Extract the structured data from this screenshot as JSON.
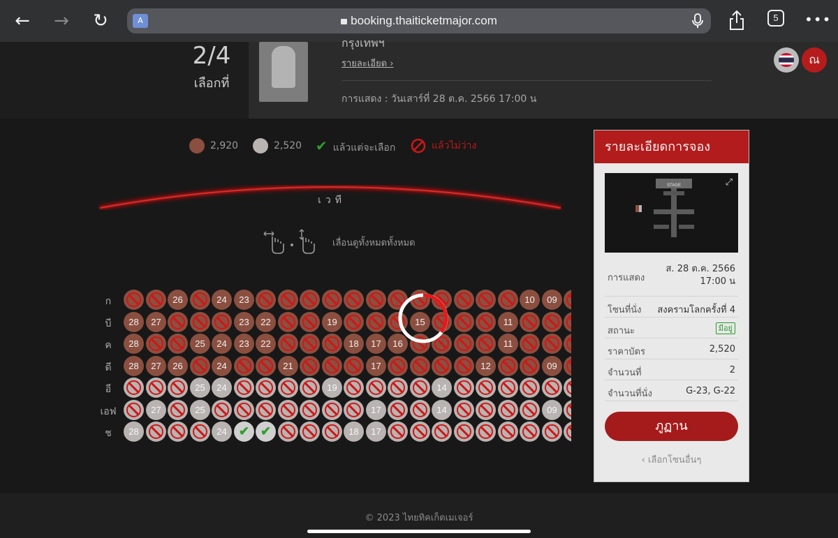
{
  "browser": {
    "url": "booking.thaiticketmajor.com",
    "tab_count": "5",
    "more": "•••",
    "translate": "A"
  },
  "event": {
    "step": "2/4",
    "step_label": "เลือกที่",
    "title": "กรุงเทพฯ",
    "detail_link": "รายละเอียด ›",
    "show": "การแสดง   : วันเสาร์ที่ 28 ต.ค. 2566 17:00 น"
  },
  "user": {
    "initial": "ณ"
  },
  "legend": [
    {
      "label": "2,920",
      "color": "#8b4f40"
    },
    {
      "label": "2,520",
      "color": "#b9b4b2"
    },
    {
      "label": "แล้วแต่จะเลือก",
      "color": "#2f9e2c"
    },
    {
      "label": "แล้วไม่ว่าง",
      "color": "#cf1717"
    }
  ],
  "stage": {
    "label": "เวที",
    "hint": "เลื่อนดูทั้งหมดทั้งหมด"
  },
  "seat_rows": [
    {
      "label": "ก",
      "seats": [
        "x",
        "x",
        "26",
        "x",
        "24",
        "23",
        "x",
        "x",
        "x",
        "x",
        "x",
        "x",
        "x",
        "x",
        "x",
        "x",
        "x",
        "x",
        "10",
        "09",
        "x"
      ],
      "zone": "z1"
    },
    {
      "label": "บี",
      "seats": [
        "28",
        "27",
        "x",
        "x",
        "x",
        "23",
        "22",
        "x",
        "x",
        "19",
        "x",
        "x",
        "x",
        "15",
        "x",
        "x",
        "x",
        "11",
        "x",
        "x",
        "x"
      ],
      "zone": "z1"
    },
    {
      "label": "ค",
      "seats": [
        "28",
        "x",
        "x",
        "25",
        "24",
        "23",
        "22",
        "x",
        "x",
        "x",
        "18",
        "17",
        "16",
        "x",
        "x",
        "x",
        "x",
        "11",
        "x",
        "x",
        "x"
      ],
      "zone": "z1"
    },
    {
      "label": "ดี",
      "seats": [
        "28",
        "27",
        "26",
        "x",
        "24",
        "x",
        "x",
        "21",
        "x",
        "x",
        "x",
        "17",
        "x",
        "x",
        "x",
        "x",
        "12",
        "x",
        "x",
        "09",
        "x"
      ],
      "zone": "z1"
    },
    {
      "label": "อี",
      "seats": [
        "x",
        "x",
        "x",
        "25",
        "24",
        "x",
        "x",
        "x",
        "x",
        "19",
        "x",
        "x",
        "x",
        "x",
        "14",
        "x",
        "x",
        "x",
        "x",
        "x",
        "x"
      ],
      "zone": "z2"
    },
    {
      "label": "เอฟ",
      "seats": [
        "x",
        "27",
        "x",
        "25",
        "x",
        "x",
        "x",
        "x",
        "x",
        "x",
        "x",
        "17",
        "x",
        "x",
        "14",
        "x",
        "x",
        "x",
        "x",
        "09",
        "x"
      ],
      "zone": "z2"
    },
    {
      "label": "ช",
      "seats": [
        "28",
        "x",
        "x",
        "x",
        "24",
        "v",
        "v",
        "x",
        "x",
        "x",
        "18",
        "17",
        "x",
        "x",
        "x",
        "x",
        "x",
        "x",
        "x",
        "x",
        "x"
      ],
      "zone": "z2"
    }
  ],
  "panel": {
    "title": "รายละเอียดการจอง",
    "minimap_stage": "STAGE",
    "rows": [
      {
        "key": "การแสดง",
        "value": "ส. 28 ต.ค. 2566\n17:00 น"
      },
      {
        "key": "โซนที่นั่ง",
        "value": "สงครามโลกครั้งที่ 4"
      },
      {
        "key": "สถานะ",
        "value": "มีอยู่"
      },
      {
        "key": "ราคาบัตร",
        "value": "2,520"
      },
      {
        "key": "จำนวนที่",
        "value": "2"
      },
      {
        "key": "จำนวนที่นั่ง",
        "value": "G-23, G-22"
      }
    ],
    "pay_label": "ภูฏาน",
    "back_label": "‹ เลือกโซนอื่นๆ"
  },
  "footer": {
    "text": "© 2023 ไทยทิคเก็ตเมเจอร์"
  },
  "colors": {
    "accent": "#b21c1c",
    "zone1": "#8b4f40",
    "zone2": "#b9b4b2",
    "blocked": "#cf1717",
    "available": "#2f9e2c"
  }
}
